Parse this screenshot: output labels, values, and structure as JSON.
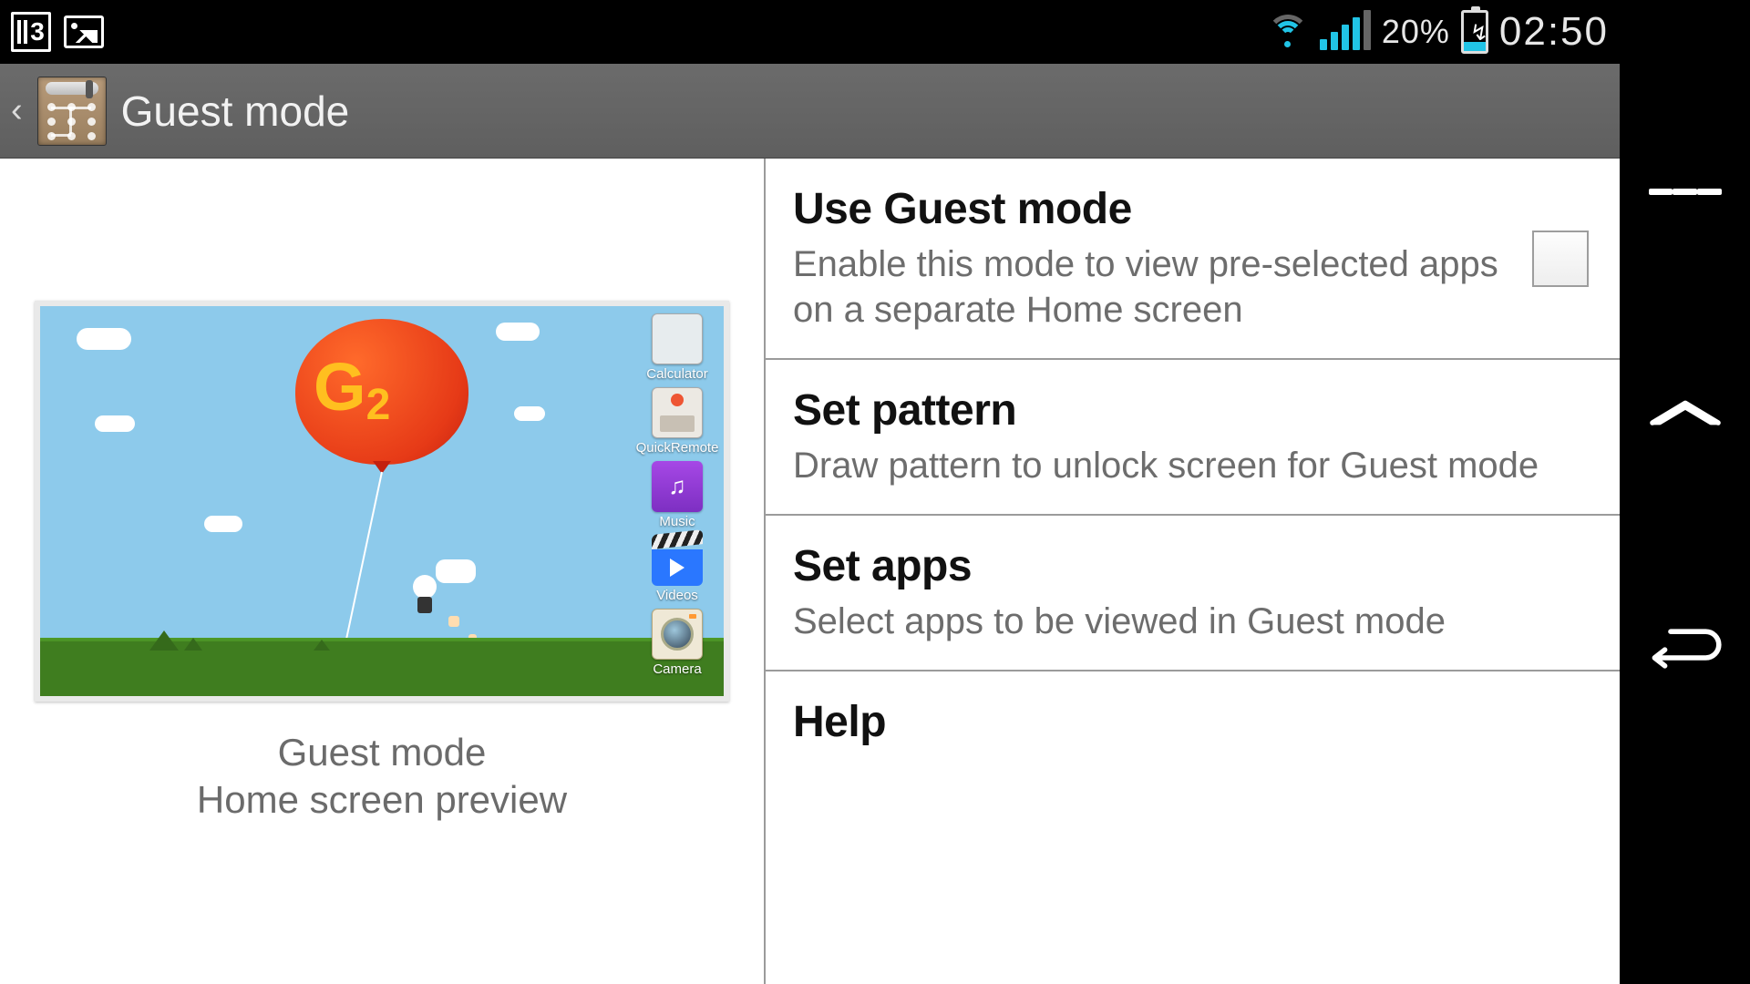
{
  "status": {
    "sim_badge": "3",
    "battery_percent": "20%",
    "time": "02:50"
  },
  "header": {
    "title": "Guest mode"
  },
  "preview": {
    "balloon_text": "G",
    "balloon_sub": "2",
    "caption_line1": "Guest mode",
    "caption_line2": "Home screen preview",
    "apps": [
      {
        "label": "Calculator"
      },
      {
        "label": "QuickRemote"
      },
      {
        "label": "Music"
      },
      {
        "label": "Videos"
      },
      {
        "label": "Camera"
      }
    ]
  },
  "settings": [
    {
      "title": "Use Guest mode",
      "desc": "Enable this mode to view pre-selected apps on a separate Home screen",
      "has_checkbox": true
    },
    {
      "title": "Set pattern",
      "desc": "Draw pattern to unlock screen for Guest mode"
    },
    {
      "title": "Set apps",
      "desc": "Select apps to be viewed in Guest mode"
    },
    {
      "title": "Help",
      "desc": ""
    }
  ]
}
